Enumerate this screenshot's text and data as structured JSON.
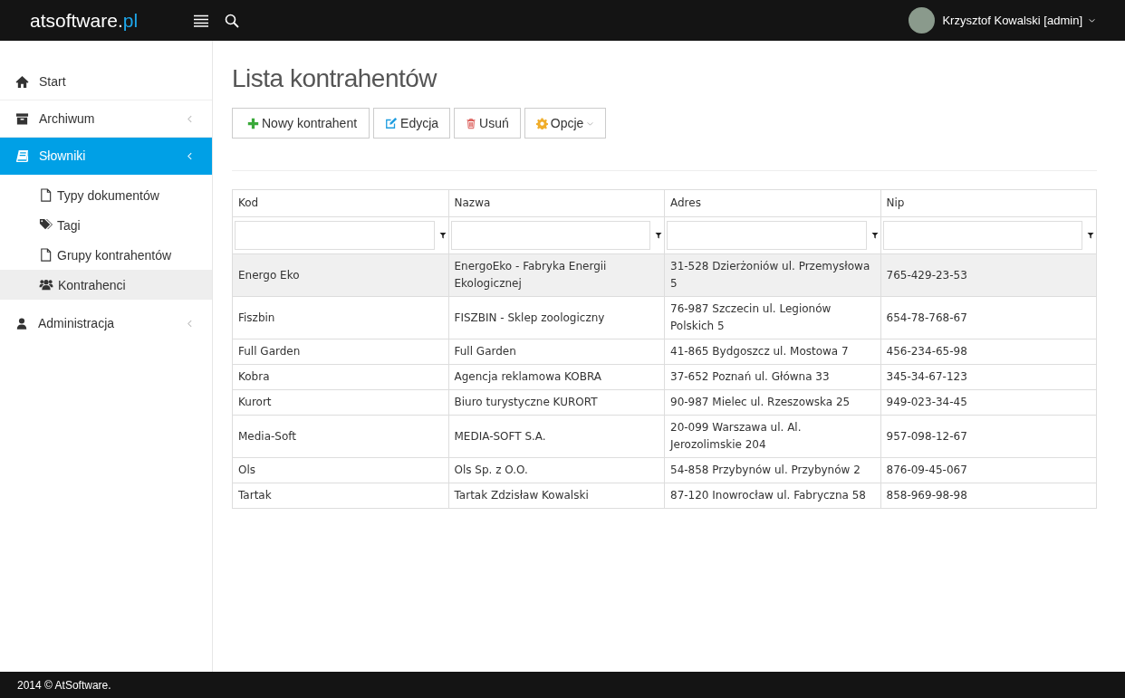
{
  "header": {
    "logo_main": "atsoftware.",
    "logo_accent": "pl",
    "user": "Krzysztof Kowalski [admin]"
  },
  "sidebar": {
    "items": [
      {
        "kind": "home",
        "label": "Start",
        "selected": false,
        "expandable": false
      },
      {
        "kind": "archive",
        "label": "Archiwum",
        "selected": false,
        "expandable": true
      },
      {
        "kind": "book",
        "label": "Słowniki",
        "selected": true,
        "expandable": true,
        "children": [
          {
            "kind": "file",
            "label": "Typy dokumentów",
            "selected": false
          },
          {
            "kind": "tags",
            "label": "Tagi",
            "selected": false
          },
          {
            "kind": "file",
            "label": "Grupy kontrahentów",
            "selected": false
          },
          {
            "kind": "users",
            "label": "Kontrahenci",
            "selected": true
          }
        ]
      },
      {
        "kind": "user",
        "label": "Administracja",
        "selected": false,
        "expandable": true
      }
    ]
  },
  "page_title": "Lista kontrahentów",
  "toolbar": [
    {
      "kind": "plus",
      "label": "Nowy kontrahent",
      "dropdown": false
    },
    {
      "kind": "edit",
      "label": "Edycja",
      "dropdown": false
    },
    {
      "kind": "trash",
      "label": "Usuń",
      "dropdown": false
    },
    {
      "kind": "gear",
      "label": "Opcje",
      "dropdown": true
    }
  ],
  "table": {
    "columns": [
      "Kod",
      "Nazwa",
      "Adres",
      "Nip"
    ],
    "rows": [
      {
        "selected": true,
        "cells": [
          "Energo Eko",
          "EnergoEko - Fabryka Energii Ekologicznej",
          "31-528 Dzierżoniów ul. Przemysłowa 5",
          "765-429-23-53"
        ]
      },
      {
        "selected": false,
        "cells": [
          "Fiszbin",
          "FISZBIN - Sklep zoologiczny",
          "76-987 Szczecin ul. Legionów Polskich 5",
          "654-78-768-67"
        ]
      },
      {
        "selected": false,
        "cells": [
          "Full Garden",
          "Full Garden",
          "41-865 Bydgoszcz ul. Mostowa 7",
          "456-234-65-98"
        ]
      },
      {
        "selected": false,
        "cells": [
          "Kobra",
          "Agencja reklamowa KOBRA",
          "37-652 Poznań ul. Główna 33",
          "345-34-67-123"
        ]
      },
      {
        "selected": false,
        "cells": [
          "Kurort",
          "Biuro turystyczne KURORT",
          "90-987 Mielec ul. Rzeszowska 25",
          "949-023-34-45"
        ]
      },
      {
        "selected": false,
        "cells": [
          "Media-Soft",
          "MEDIA-SOFT S.A.",
          "20-099 Warszawa ul. Al. Jerozolimskie 204",
          "957-098-12-67"
        ]
      },
      {
        "selected": false,
        "cells": [
          "Ols",
          "Ols Sp. z O.O.",
          "54-858 Przybynów ul. Przybynów 2",
          "876-09-45-067"
        ]
      },
      {
        "selected": false,
        "cells": [
          "Tartak",
          "Tartak Zdzisław Kowalski",
          "87-120 Inowrocław ul. Fabryczna 58",
          "858-969-98-98"
        ]
      }
    ]
  },
  "footer": "2014 © AtSoftware."
}
